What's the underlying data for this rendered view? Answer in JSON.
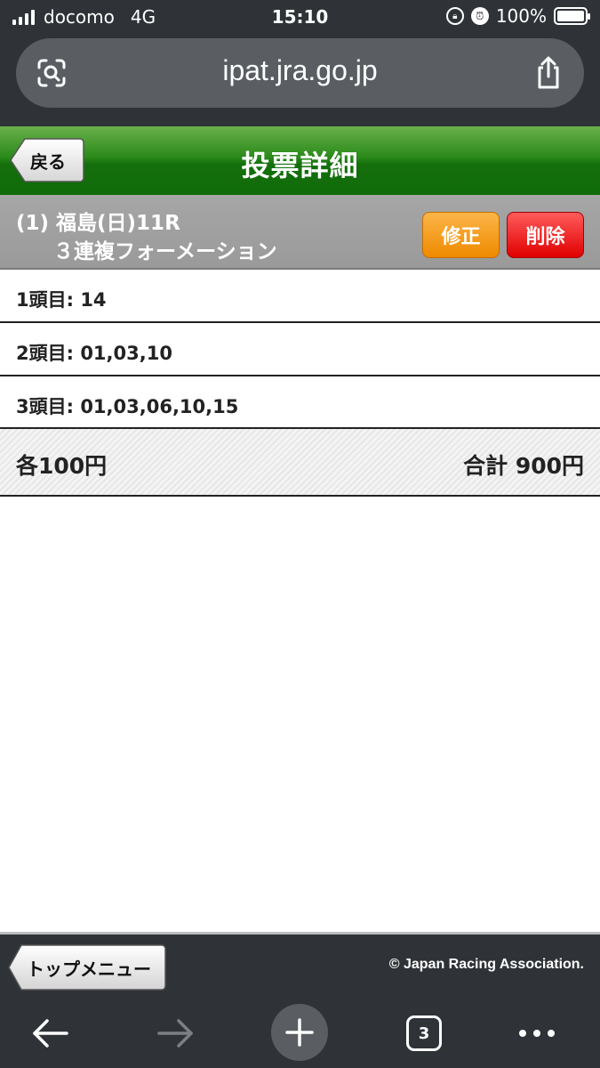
{
  "status_bar": {
    "carrier": "docomo",
    "network": "4G",
    "time": "15:10",
    "battery": "100%"
  },
  "browser": {
    "url": "ipat.jra.go.jp",
    "tabs_count": "3"
  },
  "header": {
    "back_label": "戻る",
    "title": "投票詳細"
  },
  "race": {
    "line1": "(1) 福島(日)11R",
    "line2": "３連複フォーメーション",
    "edit_label": "修正",
    "delete_label": "削除"
  },
  "selections": [
    {
      "text": "1頭目: 14"
    },
    {
      "text": "2頭目: 01,03,10"
    },
    {
      "text": "3頭目: 01,03,06,10,15"
    }
  ],
  "summary": {
    "each": "各100円",
    "total": "合計 900円"
  },
  "footer": {
    "top_menu_label": "トップメニュー",
    "copyright": "© Japan Racing Association."
  },
  "colors": {
    "header_green": "#1f7a12",
    "race_bar_gray": "#a2a2a2",
    "edit_orange": "#f39800",
    "delete_red": "#f00000",
    "chrome_dark": "#2f3337"
  }
}
